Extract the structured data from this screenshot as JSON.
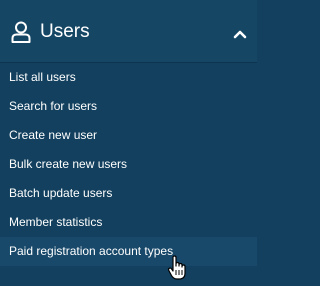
{
  "section": {
    "title": "Users",
    "icon": "user-icon",
    "toggle_icon": "chevron-up-icon",
    "expanded": true
  },
  "menu": {
    "items": [
      {
        "label": "List all users"
      },
      {
        "label": "Search for users"
      },
      {
        "label": "Create new user"
      },
      {
        "label": "Bulk create new users"
      },
      {
        "label": "Batch update users"
      },
      {
        "label": "Member statistics"
      },
      {
        "label": "Paid registration account types",
        "hovered": true
      }
    ]
  },
  "colors": {
    "panel_background": "#12405e",
    "header_background": "#154664",
    "hover_background": "#18496a",
    "text": "#ffffff"
  },
  "cursor": {
    "icon": "hand-pointer-icon"
  }
}
